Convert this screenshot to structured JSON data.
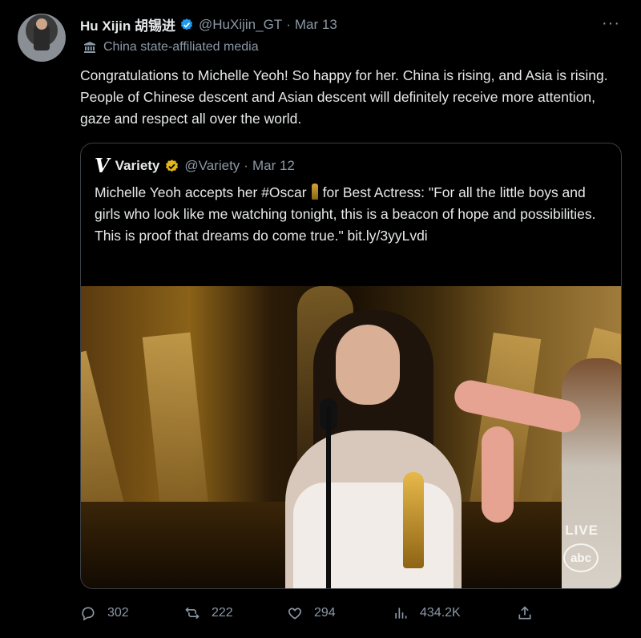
{
  "tweet": {
    "display_name": "Hu Xijin 胡锡进",
    "handle": "@HuXijin_GT",
    "separator": "·",
    "date": "Mar 13",
    "more": "···",
    "affiliation": "China state-affiliated media",
    "text": "Congratulations to Michelle Yeoh! So happy for her. China is rising, and Asia is rising. People of Chinese descent and Asian descent will definitely receive more attention, gaze and respect all over the world."
  },
  "quote": {
    "logo": "V",
    "display_name": "Variety",
    "handle": "@Variety",
    "separator": "·",
    "date": "Mar 12",
    "text_before_icon": "Michelle Yeoh accepts her #Oscar",
    "text_after_icon": "for Best Actress: \"For all the little boys and girls who look like me watching tonight, this is a beacon of hope and possibilities. This is proof that dreams do come true.\" bit.ly/3yyLvdi",
    "media": {
      "overlay_live": "LIVE",
      "overlay_network": "abc"
    }
  },
  "actions": {
    "replies": "302",
    "retweets": "222",
    "likes": "294",
    "views": "434.2K"
  },
  "colors": {
    "background": "#000000",
    "text": "#e7e9ea",
    "secondary": "#8b98a5",
    "verified_blue": "#1d9bf0",
    "verified_gold": "#e2b719"
  }
}
